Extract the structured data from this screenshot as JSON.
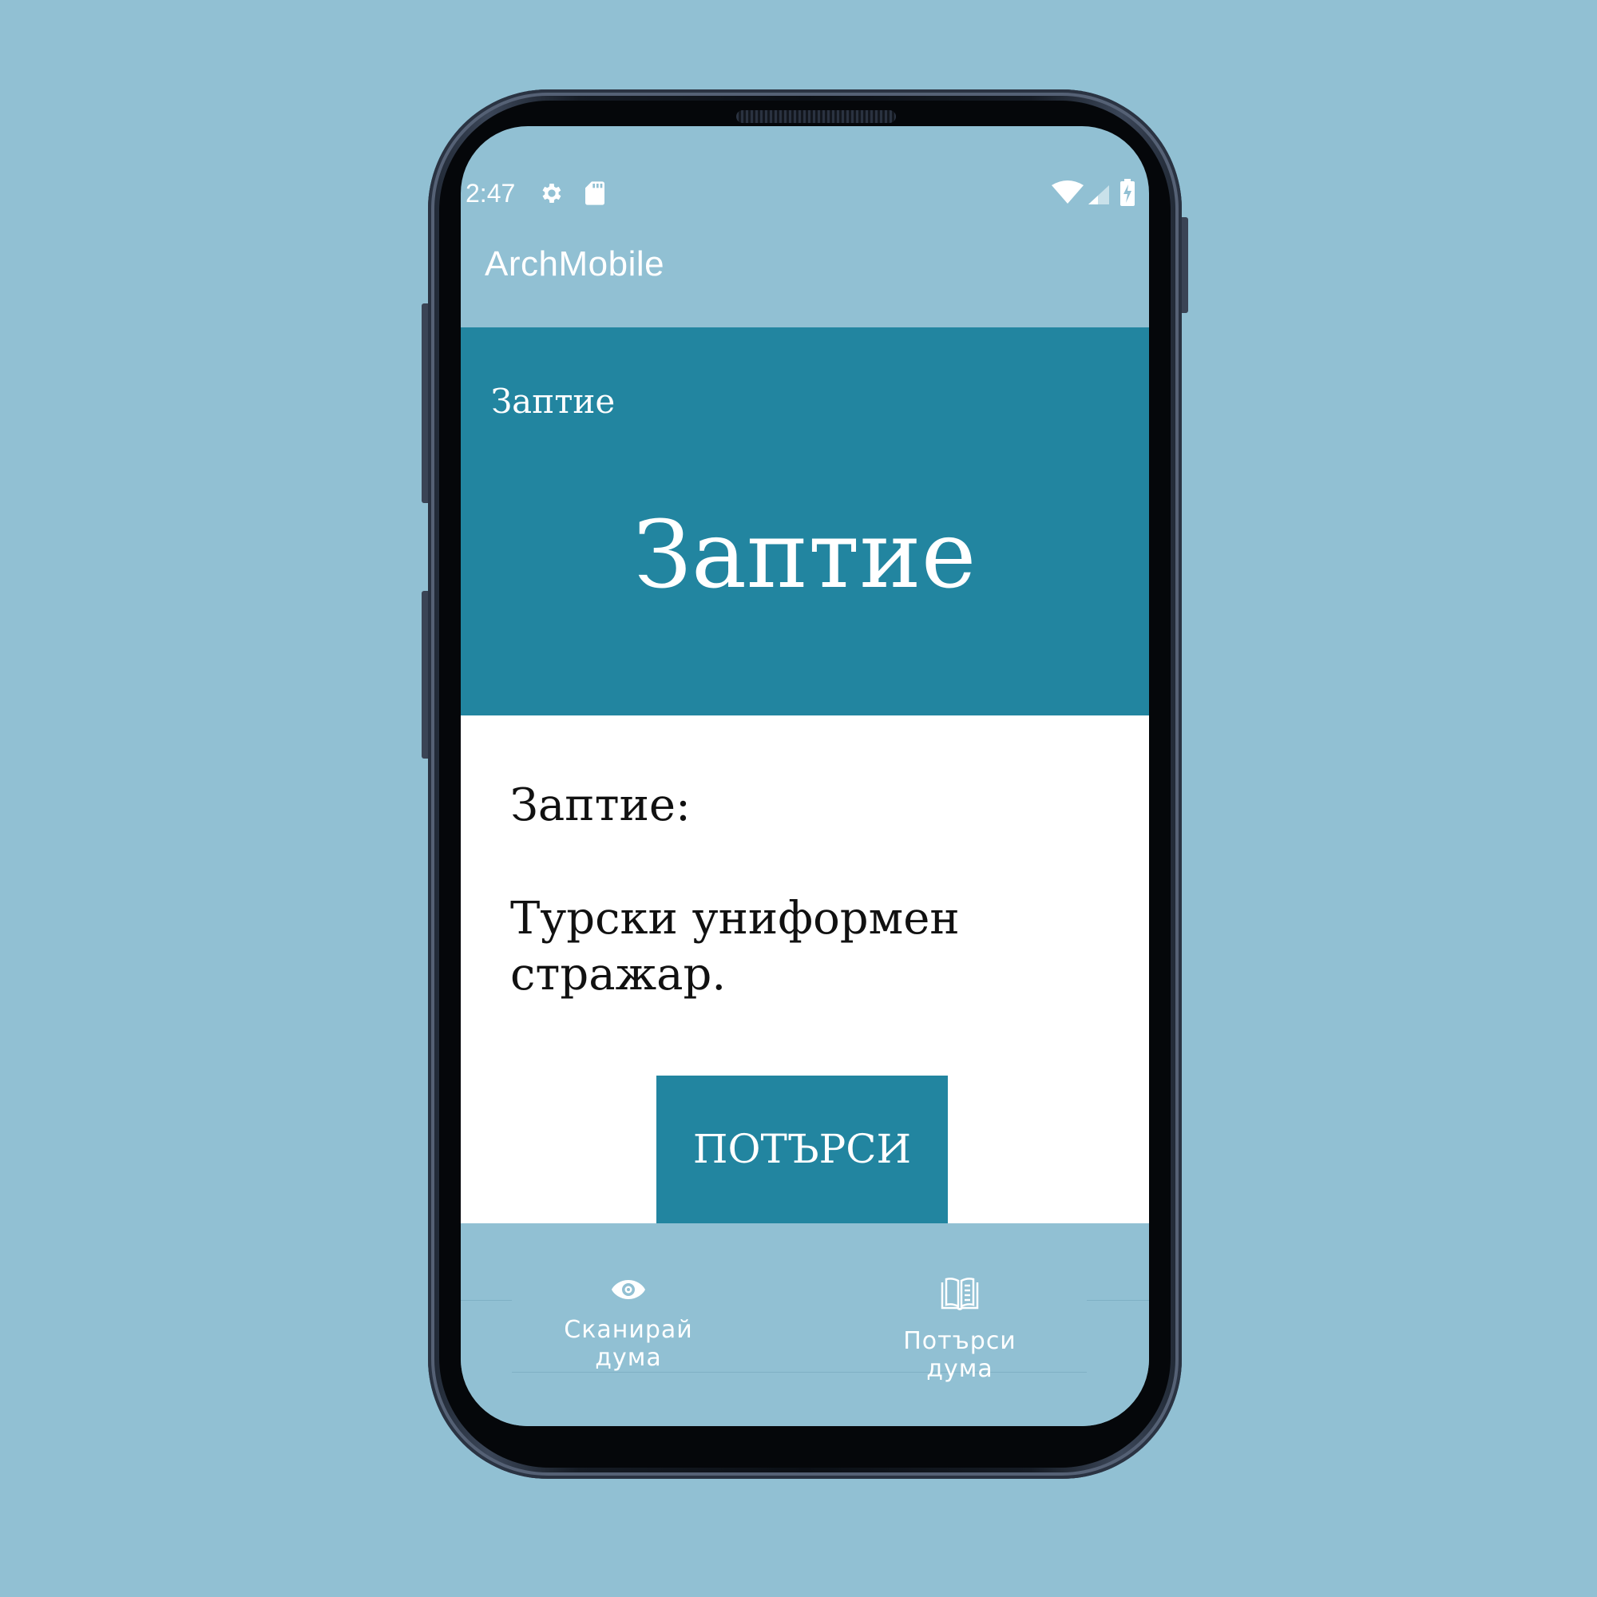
{
  "status_bar": {
    "time": "2:47",
    "icons": [
      "gear-icon",
      "sd-card-icon",
      "wifi-icon",
      "cell-signal-icon",
      "battery-charging-icon"
    ]
  },
  "app_bar": {
    "title": "ArchMobile"
  },
  "header": {
    "small_word": "Заптие",
    "big_word": "Заптие"
  },
  "definition": {
    "term": "Заптие:",
    "text": "Турски униформен стражар."
  },
  "search_button": {
    "label": "ПОТЪРСИ"
  },
  "bottom_nav": {
    "items": [
      {
        "label": "Сканирай дума",
        "icon": "eye-icon"
      },
      {
        "label": "Потърси дума",
        "icon": "book-icon"
      }
    ]
  },
  "colors": {
    "background": "#91c0d3",
    "accent": "#2285a0",
    "content_bg": "#ffffff",
    "text": "#111111"
  }
}
